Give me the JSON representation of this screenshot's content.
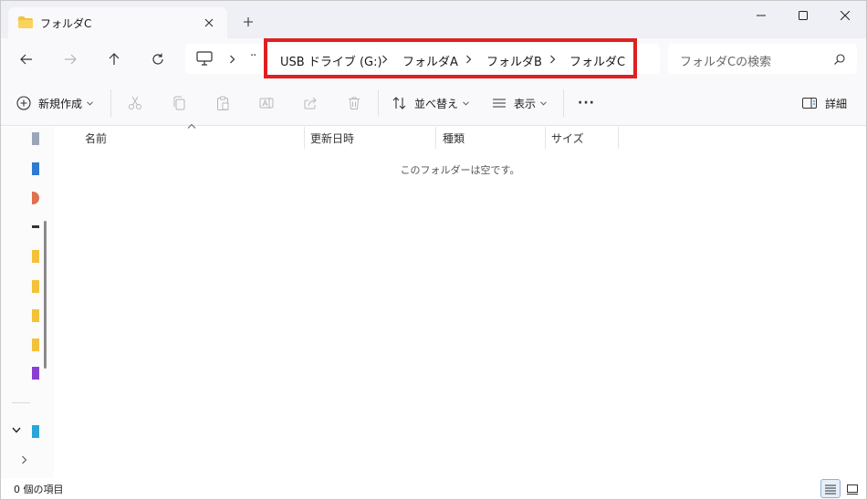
{
  "tab": {
    "title": "フォルダC",
    "close_glyph": "✕"
  },
  "new_tab_glyph": "+",
  "address": {
    "overflow": "··",
    "crumbs": [
      "USB ドライブ (G:)",
      "フォルダA",
      "フォルダB",
      "フォルダC"
    ]
  },
  "search": {
    "placeholder": "フォルダCの検索"
  },
  "commands": {
    "new_label": "新規作成",
    "sort_label": "並べ替え",
    "view_label": "表示",
    "more_label": "···",
    "details_label": "詳細"
  },
  "columns": {
    "name": "名前",
    "date": "更新日時",
    "type": "種類",
    "size": "サイズ"
  },
  "empty_message": "このフォルダーは空です。",
  "status": {
    "item_count": "0 個の項目"
  },
  "colors": {
    "accent": "#0067c0",
    "highlight_border": "#e02020",
    "folder_yellow": "#f3c13a"
  }
}
